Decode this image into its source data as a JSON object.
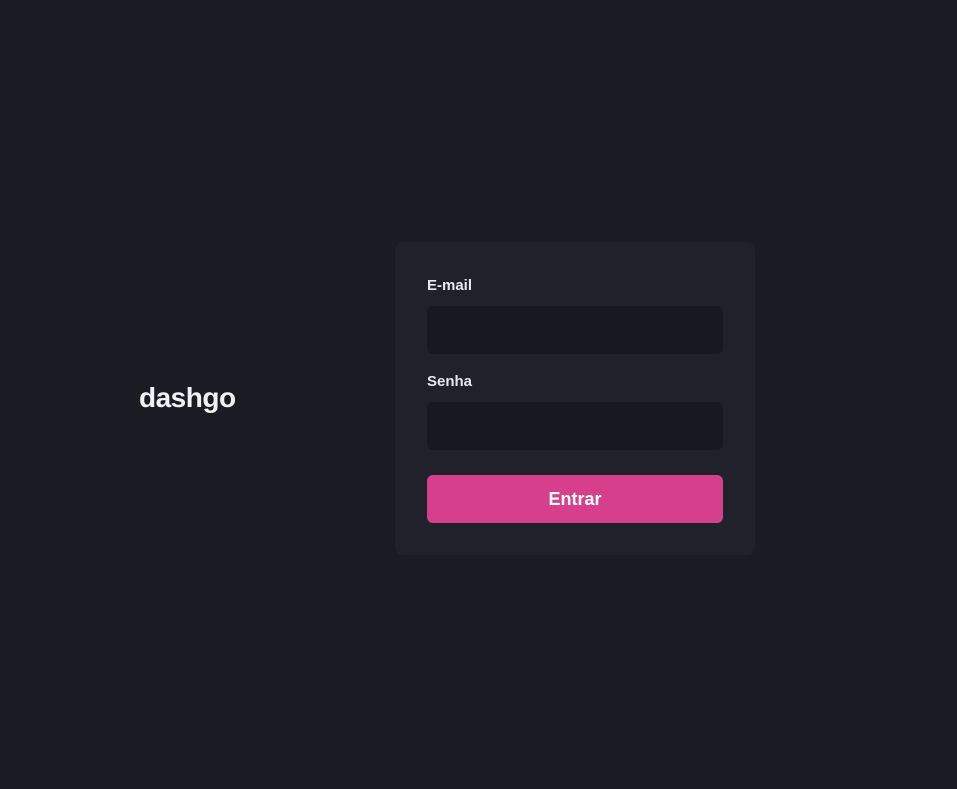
{
  "brand": {
    "logo_text": "dashgo"
  },
  "form": {
    "email": {
      "label": "E-mail",
      "value": "",
      "placeholder": ""
    },
    "password": {
      "label": "Senha",
      "value": "",
      "placeholder": ""
    },
    "submit_label": "Entrar"
  },
  "colors": {
    "background": "#1a1b23",
    "card": "#21212c",
    "input": "#181920",
    "accent": "#d53f8c",
    "text": "#eeeef2"
  }
}
